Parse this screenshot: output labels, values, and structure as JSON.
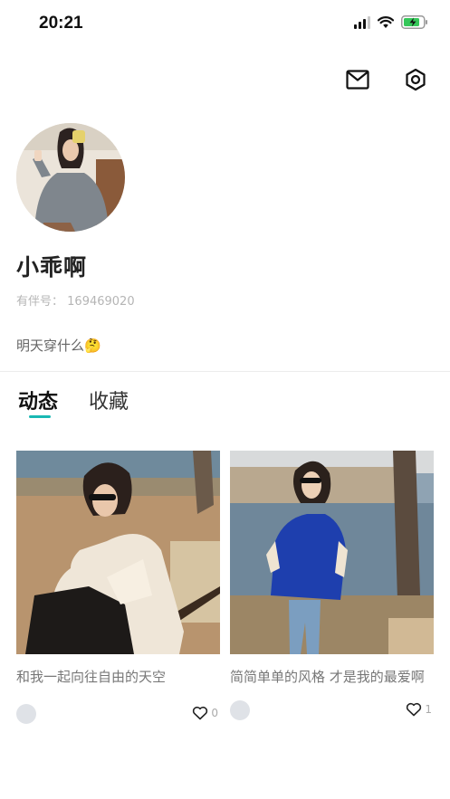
{
  "status_bar": {
    "time": "20:21",
    "battery_color": "#35c759"
  },
  "header": {
    "icons": [
      "mail-icon",
      "settings-icon"
    ]
  },
  "profile": {
    "name": "小乖啊",
    "id_label": "有伴号：",
    "id_value": "169469020",
    "bio": "明天穿什么🤔"
  },
  "tabs": [
    {
      "label": "动态",
      "active": true
    },
    {
      "label": "收藏",
      "active": false
    }
  ],
  "accent_color": "#19b8b3",
  "posts": [
    {
      "title": "和我一起向往自由的天空",
      "likes": "0"
    },
    {
      "title": "简简单单的风格 才是我的最爱啊",
      "likes": "1"
    }
  ]
}
